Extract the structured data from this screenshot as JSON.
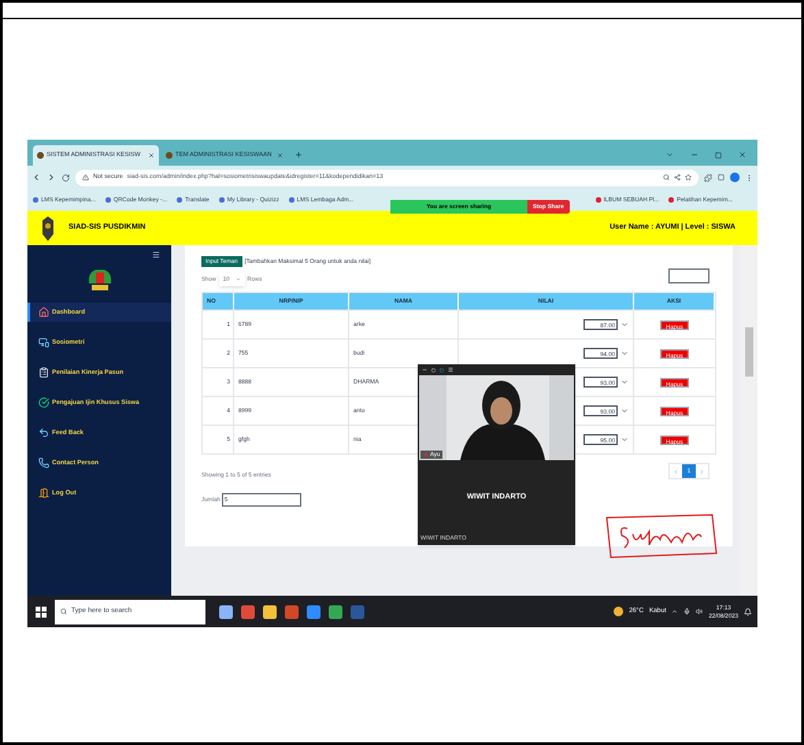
{
  "browser": {
    "tabs": [
      {
        "label": "SISTEM ADMINISTRASI KESISW",
        "selected": true
      },
      {
        "label": "TEM ADMINISTRASI KESISWAAN",
        "selected": false
      }
    ],
    "address": {
      "security": "Not secure",
      "url": "siad-sis.com/admin/index.php?hal=sosiometrisiswaupdate&idregister=11&kodependidikan=13"
    },
    "bookmarks_left": [
      "LMS Kepemimpina...",
      "QRCode Monkey -...",
      "Translate",
      "My Library - Quizizz",
      "LMS Lembaga Adm..."
    ],
    "bookmarks_right": [
      "ILBUM SEBUAH Pl...",
      "Pelatihan Kepemim..."
    ]
  },
  "share_banner": {
    "text": "You are screen sharing",
    "button": "Stop Share"
  },
  "header": {
    "title": "SIAD-SIS PUSDIKMIN",
    "user": "User Name : AYUMI | Level : SISWA"
  },
  "sidebar": {
    "items": [
      {
        "label": "Dashboard",
        "selected": true
      },
      {
        "label": "Sosiometri",
        "selected": false
      },
      {
        "label": "Penilaian Kinerja Pasun",
        "selected": false
      },
      {
        "label": "Pengajuan Ijin Khusus Siswa",
        "selected": false
      },
      {
        "label": "Feed Back",
        "selected": false
      },
      {
        "label": "Contact Person",
        "selected": false
      },
      {
        "label": "Log Out",
        "selected": false
      }
    ]
  },
  "content": {
    "add_button": "Input Teman",
    "note": "[Tambahkan Maksimal 5 Orang untuk anda nilai]",
    "show": {
      "label": "Show",
      "value": "10",
      "suffix": "Rows"
    },
    "table": {
      "columns": [
        "NO",
        "NRP/NIP",
        "NAMA",
        "NILAI",
        "AKSI"
      ],
      "rows": [
        {
          "no": "1",
          "nip": "6789",
          "nama": "arke",
          "nilai": "87.00",
          "aksi": "Hapus"
        },
        {
          "no": "2",
          "nip": "755",
          "nama": "budi",
          "nilai": "94.00",
          "aksi": "Hapus"
        },
        {
          "no": "3",
          "nip": "8888",
          "nama": "DHARMA",
          "nilai": "93.00",
          "aksi": "Hapus"
        },
        {
          "no": "4",
          "nip": "8999",
          "nama": "anto",
          "nilai": "93.00",
          "aksi": "Hapus"
        },
        {
          "no": "5",
          "nip": "gfgh",
          "nama": "nia",
          "nilai": "95.00",
          "aksi": "Hapus"
        }
      ]
    },
    "info": "Showing 1 to 5 of 5 entries",
    "page": "1",
    "total": {
      "label": "Jumlah",
      "value": "5"
    }
  },
  "video": {
    "name": "WIWIT INDARTO",
    "caption": "WIWIT INDARTO",
    "tag": "Ayu"
  },
  "taskbar": {
    "search_placeholder": "Type here to search",
    "temperature": "26°C",
    "weather": "Kabut",
    "time": "17:13",
    "date": "22/08/2023"
  }
}
